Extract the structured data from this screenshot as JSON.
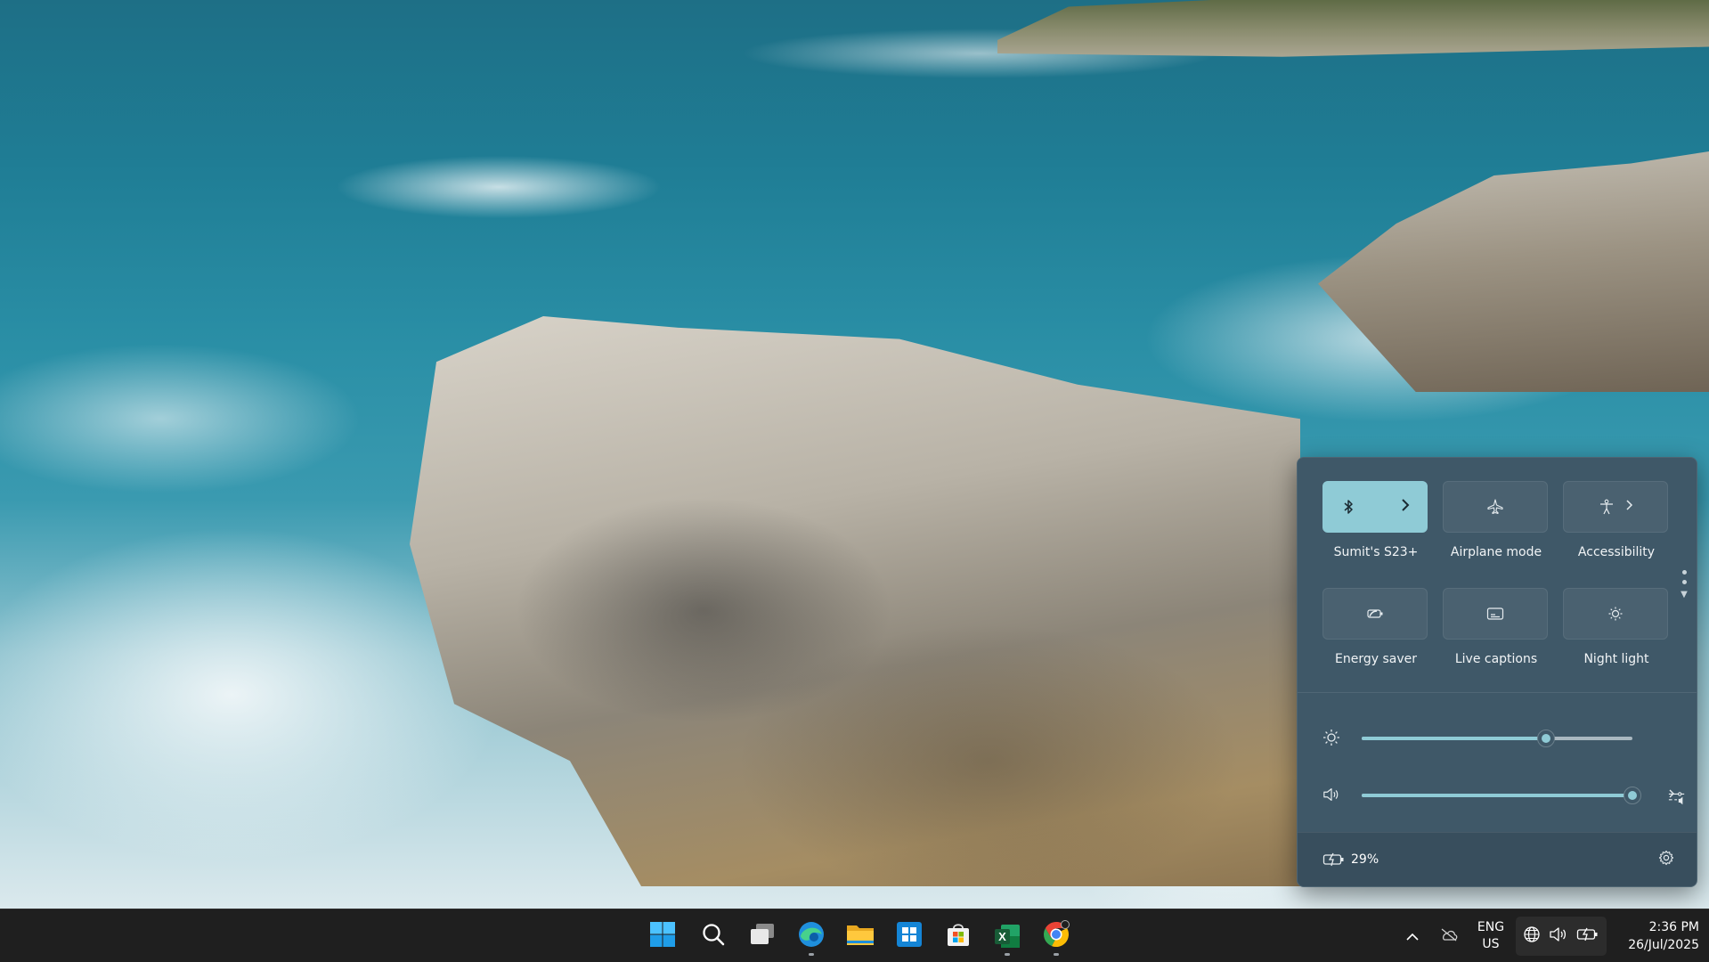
{
  "quick_settings": {
    "tiles": [
      {
        "label": "Sumit's S23+",
        "icon": "bluetooth-icon",
        "has_chevron": true,
        "active": true
      },
      {
        "label": "Airplane mode",
        "icon": "airplane-icon",
        "has_chevron": false,
        "active": false
      },
      {
        "label": "Accessibility",
        "icon": "accessibility-icon",
        "has_chevron": true,
        "active": false
      },
      {
        "label": "Energy saver",
        "icon": "energy-saver-icon",
        "has_chevron": false,
        "active": false
      },
      {
        "label": "Live captions",
        "icon": "live-captions-icon",
        "has_chevron": false,
        "active": false
      },
      {
        "label": "Night light",
        "icon": "night-light-icon",
        "has_chevron": false,
        "active": false
      }
    ],
    "brightness": {
      "icon": "brightness-icon",
      "level_percent": 68
    },
    "volume": {
      "icon": "volume-icon",
      "level_percent": 100,
      "output_icon": "audio-output-icon"
    },
    "battery": {
      "icon": "battery-charging-icon",
      "text": "29%"
    },
    "settings_icon": "gear-icon",
    "colors": {
      "accent": "#8fcbd6",
      "panel": "#3f5868",
      "taskbar": "#1f1f1f"
    }
  },
  "taskbar": {
    "apps": [
      "start-icon",
      "search-icon",
      "task-view-icon",
      "edge-icon",
      "file-explorer-icon",
      "microsoft-store-icon",
      "ms-store-bag-icon",
      "excel-icon",
      "chrome-icon"
    ],
    "excel_letter": "X",
    "tray": {
      "language_top": "ENG",
      "language_bottom": "US",
      "time": "2:36 PM",
      "date": "26/Jul/2025"
    }
  }
}
